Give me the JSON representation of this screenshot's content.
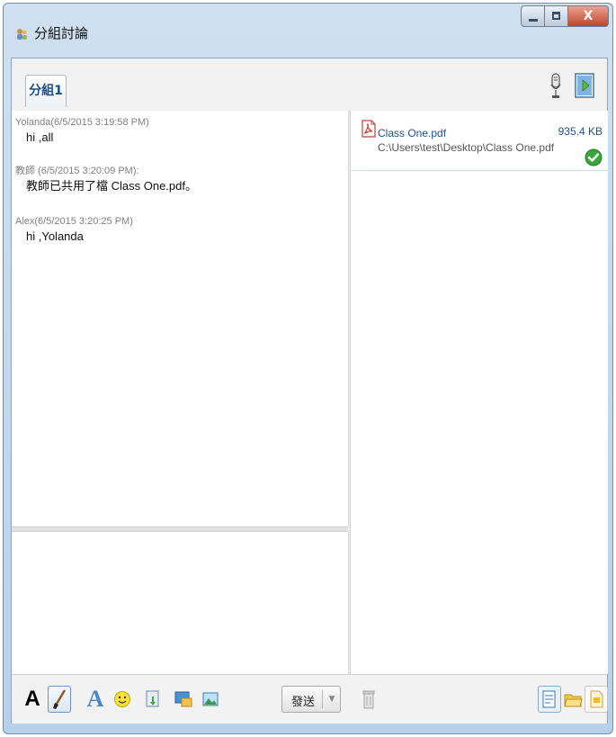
{
  "window": {
    "title": "分組討論",
    "close_glyph": "X"
  },
  "tabs": [
    {
      "label": "分組1",
      "selected": true
    }
  ],
  "chat": {
    "messages": [
      {
        "header": "Yolanda(6/5/2015 3:19:58 PM)",
        "body": "hi ,all"
      },
      {
        "header": "教師 (6/5/2015 3:20:09 PM):",
        "body": "教師已共用了檔 Class One.pdf。"
      },
      {
        "header": "Alex(6/5/2015 3:20:25 PM)",
        "body": "hi ,Yolanda"
      }
    ]
  },
  "input": {
    "value": "",
    "placeholder": ""
  },
  "files": {
    "items": [
      {
        "name": "Class One.pdf",
        "path": "C:\\Users\\test\\Desktop\\Class One.pdf",
        "size": "935.4 KB",
        "status": "check-icon"
      }
    ]
  },
  "toolbar": {
    "font_color_label": "A",
    "font_label": "A",
    "send_label": "發送",
    "send_dropdown": "▼"
  },
  "colors": {
    "accent": "#1d4f97",
    "titlebar": "#b8d1ea",
    "close": "#c1442b",
    "check": "#3aa63a"
  }
}
